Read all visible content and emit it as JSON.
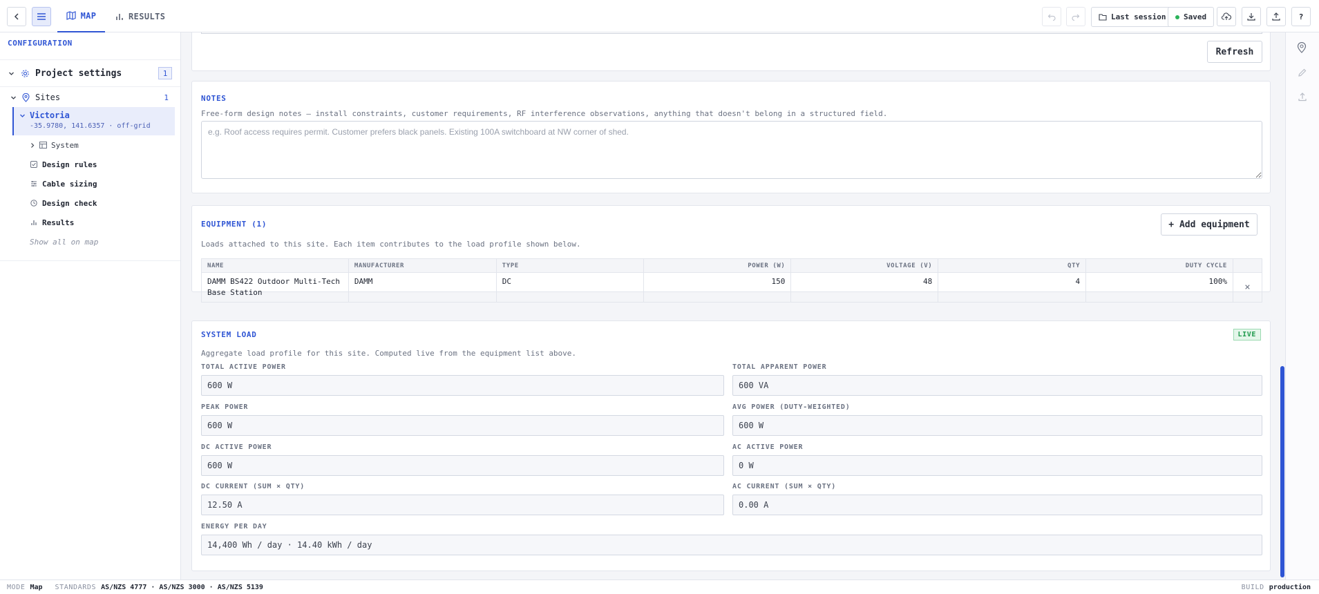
{
  "topbar": {
    "tabs": [
      {
        "label": "MAP",
        "icon": "map-icon",
        "active": true
      },
      {
        "label": "RESULTS",
        "icon": "bar-chart-icon",
        "active": false
      }
    ],
    "last_session": "Last session",
    "saved": "Saved",
    "help": "?"
  },
  "sidebar": {
    "heading": "CONFIGURATION",
    "project_settings": "Project settings",
    "project_count": "1",
    "sites_label": "Sites",
    "sites_count": "1",
    "site": {
      "name": "Victoria",
      "coords": "-35.9780, 141.6357 · off-grid"
    },
    "items": [
      {
        "label": "System",
        "icon": "table-icon"
      },
      {
        "label": "Design rules",
        "icon": "checkbox-icon"
      },
      {
        "label": "Cable sizing",
        "icon": "sliders-icon"
      },
      {
        "label": "Design check",
        "icon": "clock-icon"
      },
      {
        "label": "Results",
        "icon": "bar-chart-icon"
      }
    ],
    "show_all": "Show all on map"
  },
  "top_card": {
    "refresh": "Refresh"
  },
  "notes": {
    "title": "NOTES",
    "description": "Free-form design notes — install constraints, customer requirements, RF interference observations, anything that doesn't belong in a structured field.",
    "placeholder": "e.g. Roof access requires permit. Customer prefers black panels. Existing 100A switchboard at NW corner of shed."
  },
  "equipment": {
    "title": "EQUIPMENT (1)",
    "add_button": "+ Add equipment",
    "description": "Loads attached to this site. Each item contributes to the load profile shown below.",
    "columns": [
      "NAME",
      "MANUFACTURER",
      "TYPE",
      "POWER (W)",
      "VOLTAGE (V)",
      "QTY",
      "DUTY CYCLE"
    ],
    "rows": [
      {
        "name": "DAMM BS422 Outdoor Multi-Tech Base Station",
        "manufacturer": "DAMM",
        "type": "DC",
        "power": "150",
        "voltage": "48",
        "qty": "4",
        "duty": "100%"
      }
    ],
    "remove_glyph": "×"
  },
  "system_load": {
    "title": "SYSTEM LOAD",
    "badge": "LIVE",
    "description": "Aggregate load profile for this site. Computed live from the equipment list above.",
    "fields": {
      "total_active": {
        "label": "TOTAL ACTIVE POWER",
        "value": "600 W"
      },
      "total_apparent": {
        "label": "TOTAL APPARENT POWER",
        "value": "600 VA"
      },
      "peak": {
        "label": "PEAK POWER",
        "value": "600 W"
      },
      "avg": {
        "label": "AVG POWER (DUTY-WEIGHTED)",
        "value": "600 W"
      },
      "dc_active": {
        "label": "DC ACTIVE POWER",
        "value": "600 W"
      },
      "ac_active": {
        "label": "AC ACTIVE POWER",
        "value": "0 W"
      },
      "dc_current": {
        "label": "DC CURRENT (SUM × QTY)",
        "value": "12.50 A"
      },
      "ac_current": {
        "label": "AC CURRENT (SUM × QTY)",
        "value": "0.00 A"
      },
      "energy": {
        "label": "ENERGY PER DAY",
        "value": "14,400 Wh / day · 14.40 kWh / day"
      }
    }
  },
  "statusbar": {
    "mode_key": "MODE",
    "mode_val": "Map",
    "standards_key": "STANDARDS",
    "standards_val": "AS/NZS 4777 · AS/NZS 3000 · AS/NZS 5139",
    "build_key": "BUILD",
    "build_val": "production"
  },
  "colors": {
    "accent": "#2f55d4",
    "success": "#2bb35a"
  }
}
